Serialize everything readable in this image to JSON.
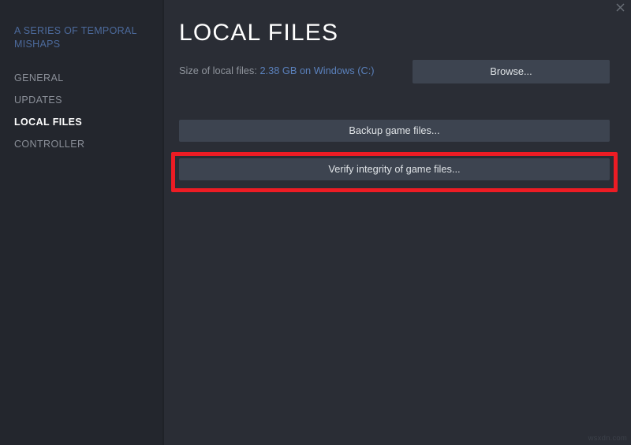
{
  "window": {
    "close_icon": "close-icon",
    "watermark": "wsxdn.com"
  },
  "sidebar": {
    "game_title": "A SERIES OF TEMPORAL MISHAPS",
    "items": [
      {
        "label": "GENERAL",
        "active": false
      },
      {
        "label": "UPDATES",
        "active": false
      },
      {
        "label": "LOCAL FILES",
        "active": true
      },
      {
        "label": "CONTROLLER",
        "active": false
      }
    ]
  },
  "main": {
    "page_title": "LOCAL FILES",
    "size_label": "Size of local files:",
    "size_value": "2.38 GB on Windows (C:)",
    "browse_label": "Browse...",
    "backup_label": "Backup game files...",
    "verify_label": "Verify integrity of game files..."
  },
  "annotation": {
    "highlight_color": "#ed1c24",
    "highlights": "verify-integrity-button"
  },
  "colors": {
    "sidebar_bg": "#23262d",
    "main_bg": "#2a2d35",
    "button_bg": "#3d4450",
    "accent_blue": "#5a80bb",
    "title_blue": "#4c6a9c",
    "active_text": "#ffffff",
    "muted_text": "#8a8f98"
  }
}
